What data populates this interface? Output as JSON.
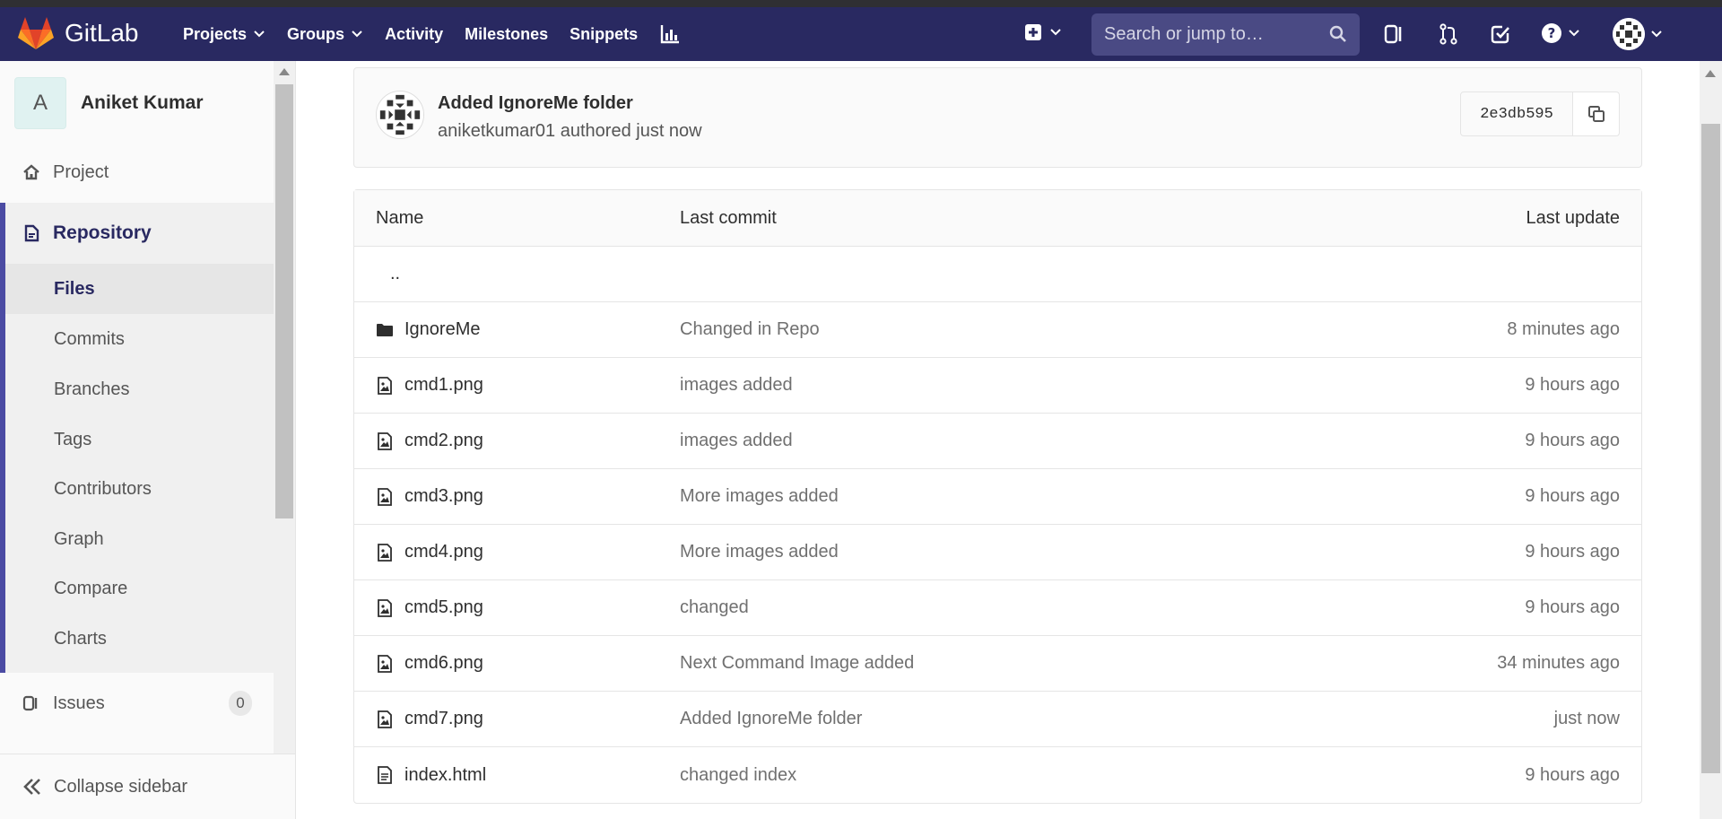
{
  "navbar": {
    "brand": "GitLab",
    "items": [
      {
        "label": "Projects",
        "dropdown": true
      },
      {
        "label": "Groups",
        "dropdown": true
      },
      {
        "label": "Activity",
        "dropdown": false
      },
      {
        "label": "Milestones",
        "dropdown": false
      },
      {
        "label": "Snippets",
        "dropdown": false
      }
    ],
    "search_placeholder": "Search or jump to…",
    "bar_color": "#292961",
    "icons": [
      "chart-icon",
      "plus-square-icon",
      "search-icon",
      "issues-icon",
      "merge-request-icon",
      "todo-check-icon",
      "help-icon",
      "user-avatar"
    ]
  },
  "sidebar": {
    "project_initial": "A",
    "project_name": "Aniket Kumar",
    "project_label": "Project",
    "repository_label": "Repository",
    "repository_items": [
      "Files",
      "Commits",
      "Branches",
      "Tags",
      "Contributors",
      "Graph",
      "Compare",
      "Charts"
    ],
    "active_item": "Files",
    "issues_label": "Issues",
    "issues_count": "0",
    "collapse_label": "Collapse sidebar",
    "accent": "#4b4ba3"
  },
  "last_commit": {
    "title": "Added IgnoreMe folder",
    "meta": "aniketkumar01 authored just now",
    "sha": "2e3db595"
  },
  "file_tree": {
    "headers": {
      "name": "Name",
      "last_commit": "Last commit",
      "last_update": "Last update"
    },
    "parent_dir": "..",
    "rows": [
      {
        "type": "folder",
        "name": "IgnoreMe",
        "commit": "Changed in Repo",
        "updated": "8 minutes ago"
      },
      {
        "type": "image",
        "name": "cmd1.png",
        "commit": "images added",
        "updated": "9 hours ago"
      },
      {
        "type": "image",
        "name": "cmd2.png",
        "commit": "images added",
        "updated": "9 hours ago"
      },
      {
        "type": "image",
        "name": "cmd3.png",
        "commit": "More images added",
        "updated": "9 hours ago"
      },
      {
        "type": "image",
        "name": "cmd4.png",
        "commit": "More images added",
        "updated": "9 hours ago"
      },
      {
        "type": "image",
        "name": "cmd5.png",
        "commit": "changed",
        "updated": "9 hours ago"
      },
      {
        "type": "image",
        "name": "cmd6.png",
        "commit": "Next Command Image added",
        "updated": "34 minutes ago"
      },
      {
        "type": "image",
        "name": "cmd7.png",
        "commit": "Added IgnoreMe folder",
        "updated": "just now"
      },
      {
        "type": "file",
        "name": "index.html",
        "commit": "changed index",
        "updated": "9 hours ago"
      }
    ]
  }
}
